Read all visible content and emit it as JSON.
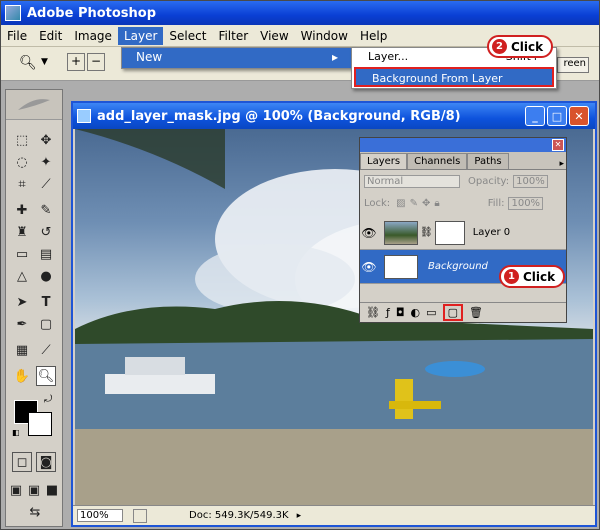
{
  "app": {
    "title": "Adobe Photoshop"
  },
  "menubar": {
    "items": [
      "File",
      "Edit",
      "Image",
      "Layer",
      "Select",
      "Filter",
      "View",
      "Window",
      "Help"
    ]
  },
  "layer_menu": {
    "new_label": "New"
  },
  "new_submenu": {
    "items": [
      "Layer...",
      "Background From Layer"
    ],
    "shortcut": "Shift+"
  },
  "options_bar": {
    "screen_label": "reen"
  },
  "document": {
    "title": "add_layer_mask.jpg @ 100% (Background, RGB/8)",
    "zoom": "100%",
    "doc_size": "Doc: 549.3K/549.3K"
  },
  "layers_panel": {
    "tabs": [
      "Layers",
      "Channels",
      "Paths"
    ],
    "blend_mode": "Normal",
    "opacity_label": "Opacity:",
    "opacity": "100%",
    "lock_label": "Lock:",
    "fill_label": "Fill:",
    "fill": "100%",
    "layers": [
      {
        "name": "Layer 0"
      },
      {
        "name": "Background"
      }
    ]
  },
  "callouts": [
    {
      "number": "2",
      "text": "Click"
    },
    {
      "number": "1",
      "text": "Click"
    }
  ]
}
